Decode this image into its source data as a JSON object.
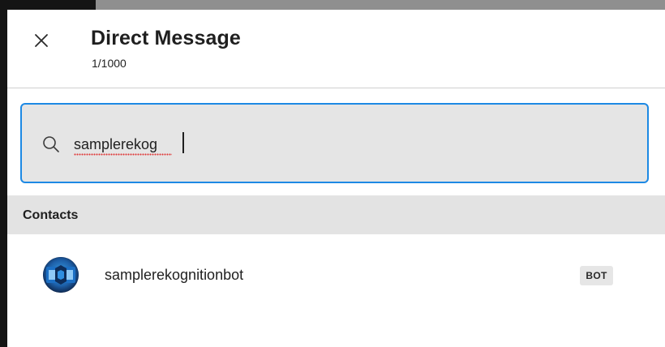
{
  "dialog": {
    "title": "Direct Message",
    "counter": "1/1000",
    "close_icon": "close-icon"
  },
  "search": {
    "value": "samplerekog",
    "icon": "search-icon",
    "focus_color": "#1d89e4",
    "spellcheck_flag_color": "#e03a3a"
  },
  "sections": {
    "contacts_label": "Contacts"
  },
  "contacts": [
    {
      "name": "samplerekognitionbot",
      "badge": "BOT",
      "avatar_icon": "aws-rekognition-icon"
    }
  ],
  "colors": {
    "accent": "#1d89e4",
    "section_background": "#e3e3e3",
    "search_background": "#e5e5e5",
    "avatar_background": "#0b1c3c"
  }
}
